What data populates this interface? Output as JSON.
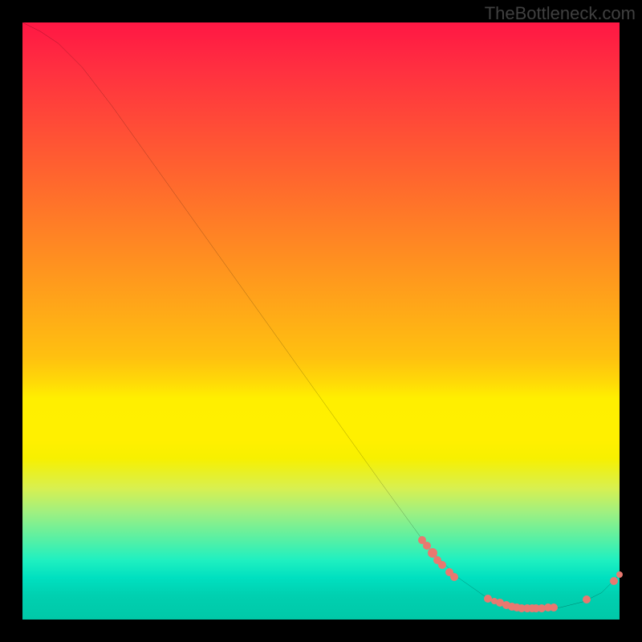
{
  "attribution": "TheBottleneck.com",
  "chart_data": {
    "type": "line",
    "xlabel": "",
    "ylabel": "",
    "xlim": [
      0,
      100
    ],
    "ylim": [
      0,
      100
    ],
    "title": "",
    "curve": [
      {
        "x": 0.0,
        "y": 100.0
      },
      {
        "x": 3.0,
        "y": 98.5
      },
      {
        "x": 6.0,
        "y": 96.5
      },
      {
        "x": 10.0,
        "y": 92.5
      },
      {
        "x": 15.0,
        "y": 86.0
      },
      {
        "x": 20.0,
        "y": 79.0
      },
      {
        "x": 30.0,
        "y": 65.0
      },
      {
        "x": 40.0,
        "y": 51.0
      },
      {
        "x": 50.0,
        "y": 37.0
      },
      {
        "x": 60.0,
        "y": 23.0
      },
      {
        "x": 68.0,
        "y": 12.0
      },
      {
        "x": 73.0,
        "y": 7.0
      },
      {
        "x": 78.0,
        "y": 3.5
      },
      {
        "x": 82.0,
        "y": 2.0
      },
      {
        "x": 86.0,
        "y": 1.8
      },
      {
        "x": 90.0,
        "y": 2.0
      },
      {
        "x": 94.0,
        "y": 3.0
      },
      {
        "x": 97.0,
        "y": 4.5
      },
      {
        "x": 100.0,
        "y": 7.5
      }
    ],
    "clusters": [
      {
        "x": 67.0,
        "y": 13.3,
        "r": 5
      },
      {
        "x": 67.8,
        "y": 12.3,
        "r": 5
      },
      {
        "x": 68.7,
        "y": 11.1,
        "r": 6
      },
      {
        "x": 69.5,
        "y": 10.0,
        "r": 5
      },
      {
        "x": 70.3,
        "y": 9.1,
        "r": 5
      },
      {
        "x": 71.5,
        "y": 7.9,
        "r": 5
      },
      {
        "x": 72.3,
        "y": 7.1,
        "r": 5
      },
      {
        "x": 78.0,
        "y": 3.5,
        "r": 5
      },
      {
        "x": 79.0,
        "y": 3.1,
        "r": 4
      },
      {
        "x": 80.0,
        "y": 2.8,
        "r": 5
      },
      {
        "x": 81.0,
        "y": 2.4,
        "r": 5
      },
      {
        "x": 82.0,
        "y": 2.1,
        "r": 5
      },
      {
        "x": 82.8,
        "y": 2.0,
        "r": 5
      },
      {
        "x": 83.6,
        "y": 1.9,
        "r": 5
      },
      {
        "x": 84.5,
        "y": 1.85,
        "r": 5
      },
      {
        "x": 85.3,
        "y": 1.85,
        "r": 5
      },
      {
        "x": 86.0,
        "y": 1.85,
        "r": 5
      },
      {
        "x": 87.0,
        "y": 1.9,
        "r": 5
      },
      {
        "x": 88.0,
        "y": 1.95,
        "r": 5
      },
      {
        "x": 89.0,
        "y": 2.0,
        "r": 5
      },
      {
        "x": 94.5,
        "y": 3.3,
        "r": 5
      },
      {
        "x": 99.0,
        "y": 6.5,
        "r": 5
      },
      {
        "x": 100.0,
        "y": 7.5,
        "r": 4
      }
    ]
  }
}
